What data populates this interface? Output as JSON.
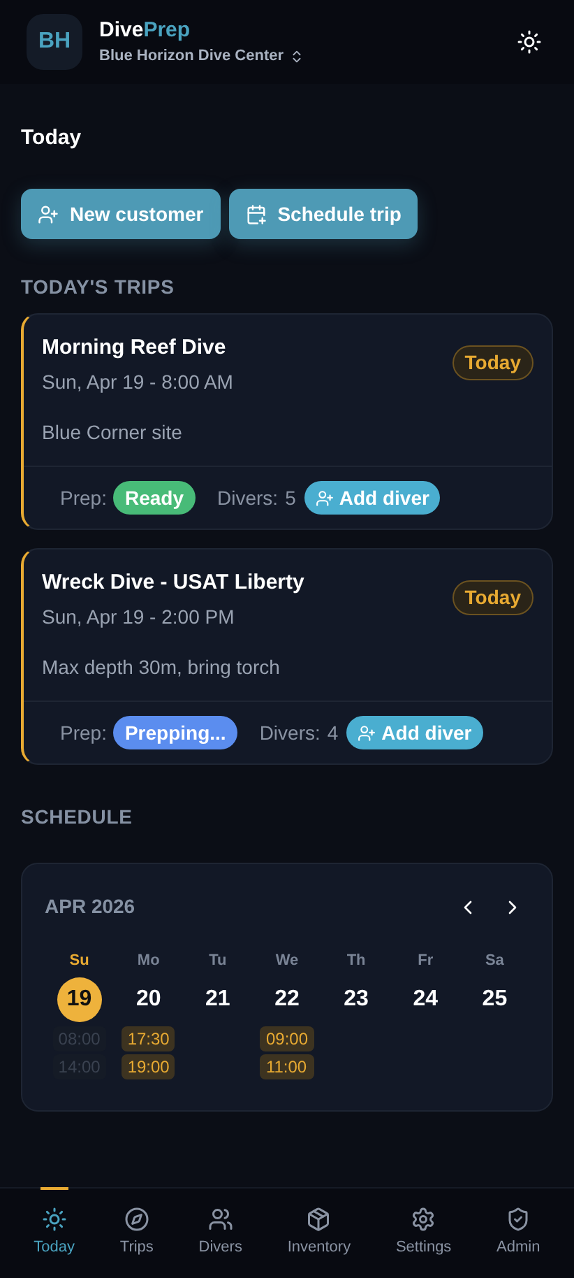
{
  "header": {
    "logo": "BH",
    "brand_first": "Dive",
    "brand_second": "Prep",
    "center": "Blue Horizon Dive Center"
  },
  "page_title": "Today",
  "actions": [
    {
      "label": "New customer"
    },
    {
      "label": "Schedule trip"
    }
  ],
  "trips_heading": "TODAY'S TRIPS",
  "trips": [
    {
      "title": "Morning Reef Dive",
      "when": "Sun, Apr 19 - 8:00 AM",
      "badge": "Today",
      "note": "Blue Corner site",
      "prep_label": "Prep:",
      "prep": {
        "label": "Ready",
        "color": "#48bb78"
      },
      "divers_label": "Divers:",
      "divers": "5",
      "add": "Add diver"
    },
    {
      "title": "Wreck Dive - USAT Liberty",
      "when": "Sun, Apr 19 - 2:00 PM",
      "badge": "Today",
      "note": "Max depth 30m, bring torch",
      "prep_label": "Prep:",
      "prep": {
        "label": "Prepping...",
        "color": "#5b8def"
      },
      "divers_label": "Divers:",
      "divers": "4",
      "add": "Add diver"
    }
  ],
  "schedule_heading": "SCHEDULE",
  "calendar": {
    "month": "APR 2026",
    "days": [
      {
        "weekday": "Su",
        "date": "19",
        "selected": true,
        "events": [
          {
            "time": "08:00",
            "past": true
          },
          {
            "time": "14:00",
            "past": true
          }
        ]
      },
      {
        "weekday": "Mo",
        "date": "20",
        "selected": false,
        "events": [
          {
            "time": "17:30",
            "past": false
          },
          {
            "time": "19:00",
            "past": false
          }
        ]
      },
      {
        "weekday": "Tu",
        "date": "21",
        "selected": false
      },
      {
        "weekday": "We",
        "date": "22",
        "selected": false,
        "events": [
          {
            "time": "09:00",
            "past": false
          },
          {
            "time": "11:00",
            "past": false
          }
        ]
      },
      {
        "weekday": "Th",
        "date": "23",
        "selected": false
      },
      {
        "weekday": "Fr",
        "date": "24",
        "selected": false
      },
      {
        "weekday": "Sa",
        "date": "25",
        "selected": false
      }
    ]
  },
  "nav": [
    {
      "label": "Today",
      "selected": true
    },
    {
      "label": "Trips",
      "selected": false
    },
    {
      "label": "Divers",
      "selected": false
    },
    {
      "label": "Inventory",
      "selected": false
    },
    {
      "label": "Settings",
      "selected": false
    },
    {
      "label": "Admin",
      "selected": false
    }
  ]
}
